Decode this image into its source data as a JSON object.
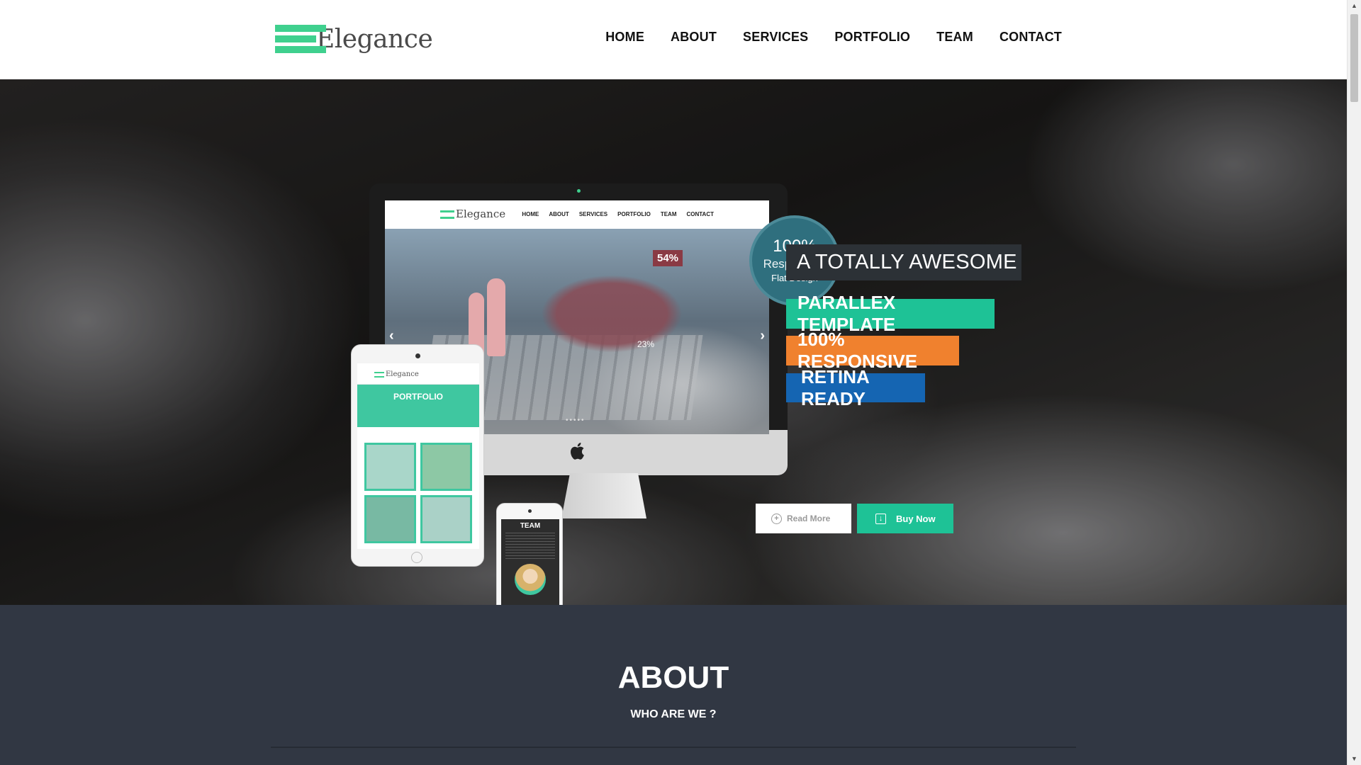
{
  "brand": {
    "logo_text": "Elegance"
  },
  "nav": {
    "items": [
      "HOME",
      "ABOUT",
      "SERVICES",
      "PORTFOLIO",
      "TEAM",
      "CONTACT"
    ]
  },
  "hero": {
    "badge": {
      "line1": "100%",
      "line2": "Responsive",
      "line3": "Flat Design"
    },
    "taglines": [
      "A TOTALLY AWESOME",
      "PARALLEX TEMPLATE",
      "100% RESPONSIVE",
      "RETINA READY"
    ],
    "buttons": {
      "read_more": "Read More",
      "buy_now": "Buy Now"
    },
    "mockup": {
      "monitor_logo": "Elegance",
      "monitor_nav": [
        "HOME",
        "ABOUT",
        "SERVICES",
        "PORTFOLIO",
        "TEAM",
        "CONTACT"
      ],
      "stat_1": "54%",
      "stat_2": "23%",
      "tablet_logo": "Elegance",
      "tablet_title": "PORTFOLIO",
      "phone_title": "TEAM"
    },
    "colors": {
      "teal": "#1ec296",
      "orange": "#f0812e",
      "blue": "#1565b2",
      "dark": "#2c3136",
      "badge": "#2f6f7e"
    }
  },
  "about": {
    "title": "ABOUT",
    "subtitle": "WHO ARE WE ?"
  },
  "icons": {
    "read_more": "plus-circle-icon",
    "buy_now": "download-icon",
    "slider_prev": "chevron-left-icon",
    "slider_next": "chevron-right-icon"
  }
}
